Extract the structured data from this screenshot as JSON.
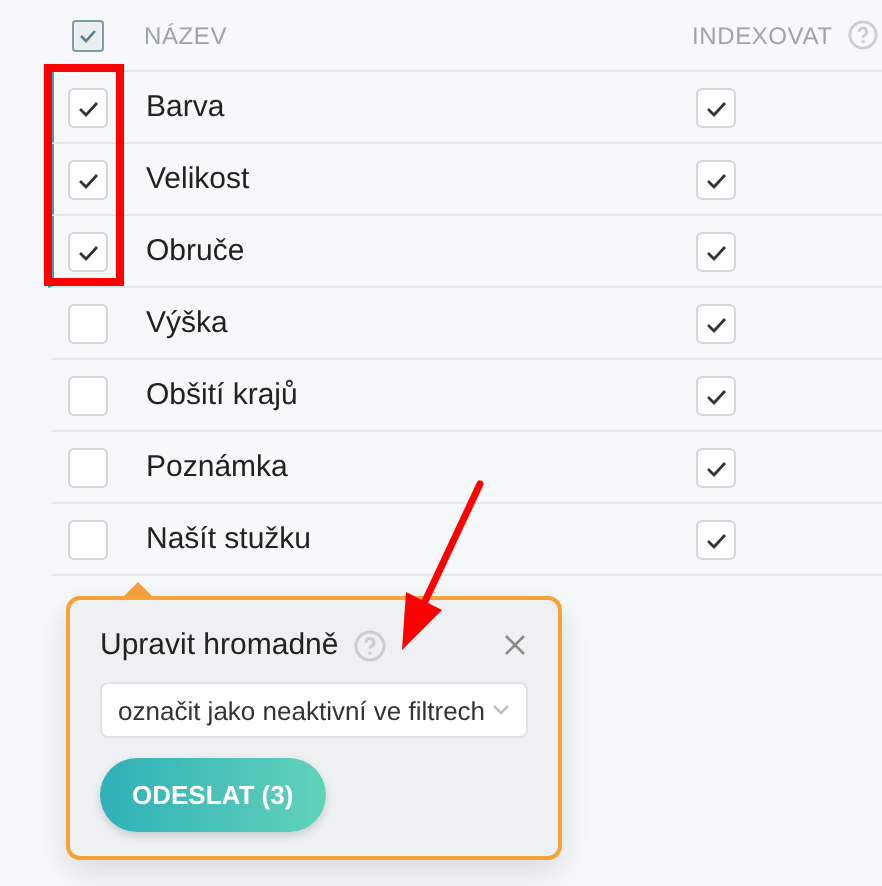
{
  "header": {
    "select_all_checked": true,
    "columns": [
      "NÁZEV",
      "INDEXOVAT"
    ]
  },
  "rows": [
    {
      "name": "Barva",
      "selected": true,
      "indexed": true
    },
    {
      "name": "Velikost",
      "selected": true,
      "indexed": true
    },
    {
      "name": "Obruče",
      "selected": true,
      "indexed": true
    },
    {
      "name": "Výška",
      "selected": false,
      "indexed": true
    },
    {
      "name": "Obšití krajů",
      "selected": false,
      "indexed": true
    },
    {
      "name": "Poznámka",
      "selected": false,
      "indexed": true
    },
    {
      "name": "Našít stužku",
      "selected": false,
      "indexed": true
    }
  ],
  "popup": {
    "title": "Upravit hromadně",
    "action": "označit jako neaktivní ve filtrech",
    "submit": "ODESLAT (3)"
  }
}
